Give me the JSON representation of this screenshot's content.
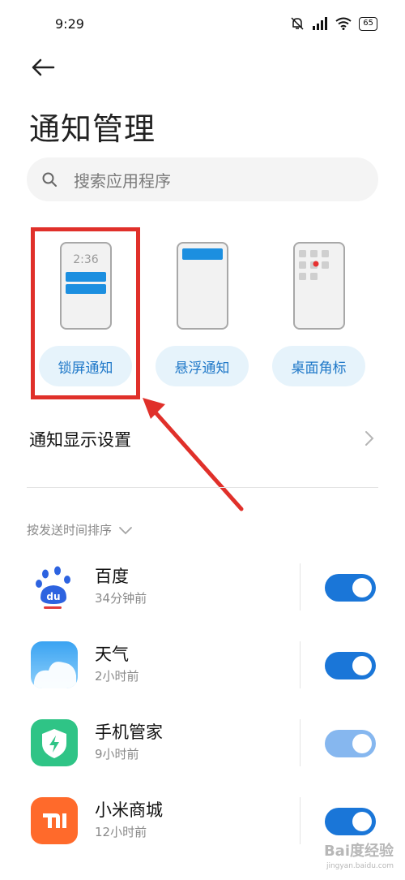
{
  "status_bar": {
    "time": "9:29",
    "battery": "65"
  },
  "page": {
    "title": "通知管理"
  },
  "search": {
    "placeholder": "搜索应用程序"
  },
  "notification_types": [
    {
      "label": "锁屏通知",
      "preview_time": "2:36",
      "selected": true
    },
    {
      "label": "悬浮通知"
    },
    {
      "label": "桌面角标"
    }
  ],
  "display_settings": {
    "label": "通知显示设置"
  },
  "sort": {
    "label": "按发送时间排序"
  },
  "apps": [
    {
      "name": "百度",
      "time": "34分钟前",
      "enabled": true,
      "icon": "baidu-icon"
    },
    {
      "name": "天气",
      "time": "2小时前",
      "enabled": true,
      "icon": "weather-icon"
    },
    {
      "name": "手机管家",
      "time": "9小时前",
      "enabled": true,
      "toggle_disabled": true,
      "icon": "security-icon"
    },
    {
      "name": "小米商城",
      "time": "12小时前",
      "enabled": true,
      "icon": "mi-store-icon"
    }
  ],
  "colors": {
    "accent": "#1a76d8",
    "chip_bg": "#e6f3fb",
    "chip_text": "#1f78c8",
    "highlight": "#e0302a"
  },
  "watermark": {
    "brand": "Bai度经验",
    "url": "jingyan.baidu.com"
  }
}
